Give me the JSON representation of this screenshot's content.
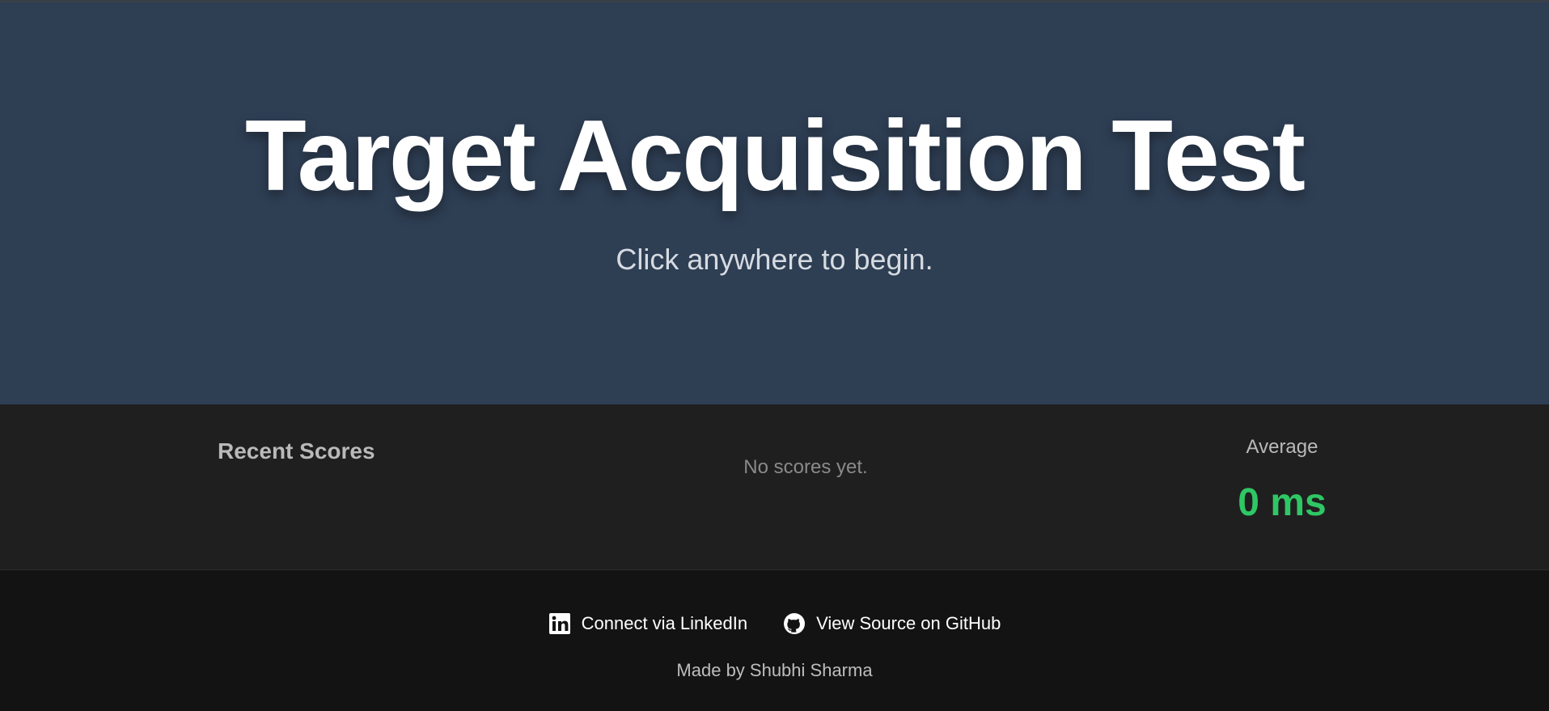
{
  "hero": {
    "title": "Target Acquisition Test",
    "subtitle": "Click anywhere to begin.",
    "background_color": "#2e3e53"
  },
  "scores": {
    "recent_title": "Recent Scores",
    "empty_message": "No scores yet.",
    "average_label": "Average",
    "average_value": "0 ms",
    "average_color": "#2fc765"
  },
  "footer": {
    "links": [
      {
        "label": "Connect via LinkedIn",
        "icon": "linkedin-icon"
      },
      {
        "label": "View Source on GitHub",
        "icon": "github-icon"
      }
    ],
    "credit": "Made by Shubhi Sharma"
  }
}
